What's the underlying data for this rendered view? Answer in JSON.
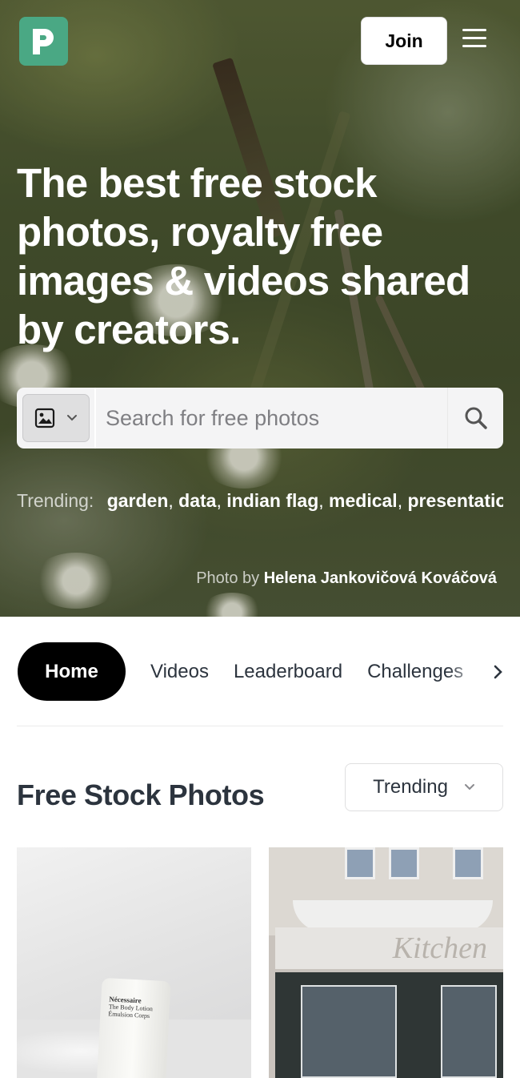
{
  "header": {
    "logo_letter": "P",
    "join_label": "Join",
    "menu_icon": "hamburger-menu-icon"
  },
  "hero": {
    "headline": "The best free stock photos, royalty free images & videos shared by creators.",
    "search": {
      "type_icon": "image-icon",
      "placeholder": "Search for free photos",
      "search_icon": "magnifier-icon"
    },
    "trending": {
      "label": "Trending:",
      "items": [
        "garden",
        "data",
        "indian flag",
        "medical",
        "presentation"
      ]
    },
    "credit": {
      "prefix": "Photo by",
      "author": "Helena Jankovičová Kováčová"
    }
  },
  "tabs": [
    {
      "label": "Home",
      "active": true
    },
    {
      "label": "Videos",
      "active": false
    },
    {
      "label": "Leaderboard",
      "active": false
    },
    {
      "label": "Challenges",
      "active": false
    }
  ],
  "section": {
    "title": "Free Stock Photos",
    "sort_value": "Trending"
  },
  "photos": [
    {
      "product_text": [
        "Nécessaire",
        "The Body Lotion",
        "Émulsion Corps"
      ]
    },
    {
      "sign_text": "Kitchen"
    }
  ],
  "colors": {
    "brand": "#4aa884",
    "active_tab_bg": "#000000",
    "text": "#2c343e"
  }
}
